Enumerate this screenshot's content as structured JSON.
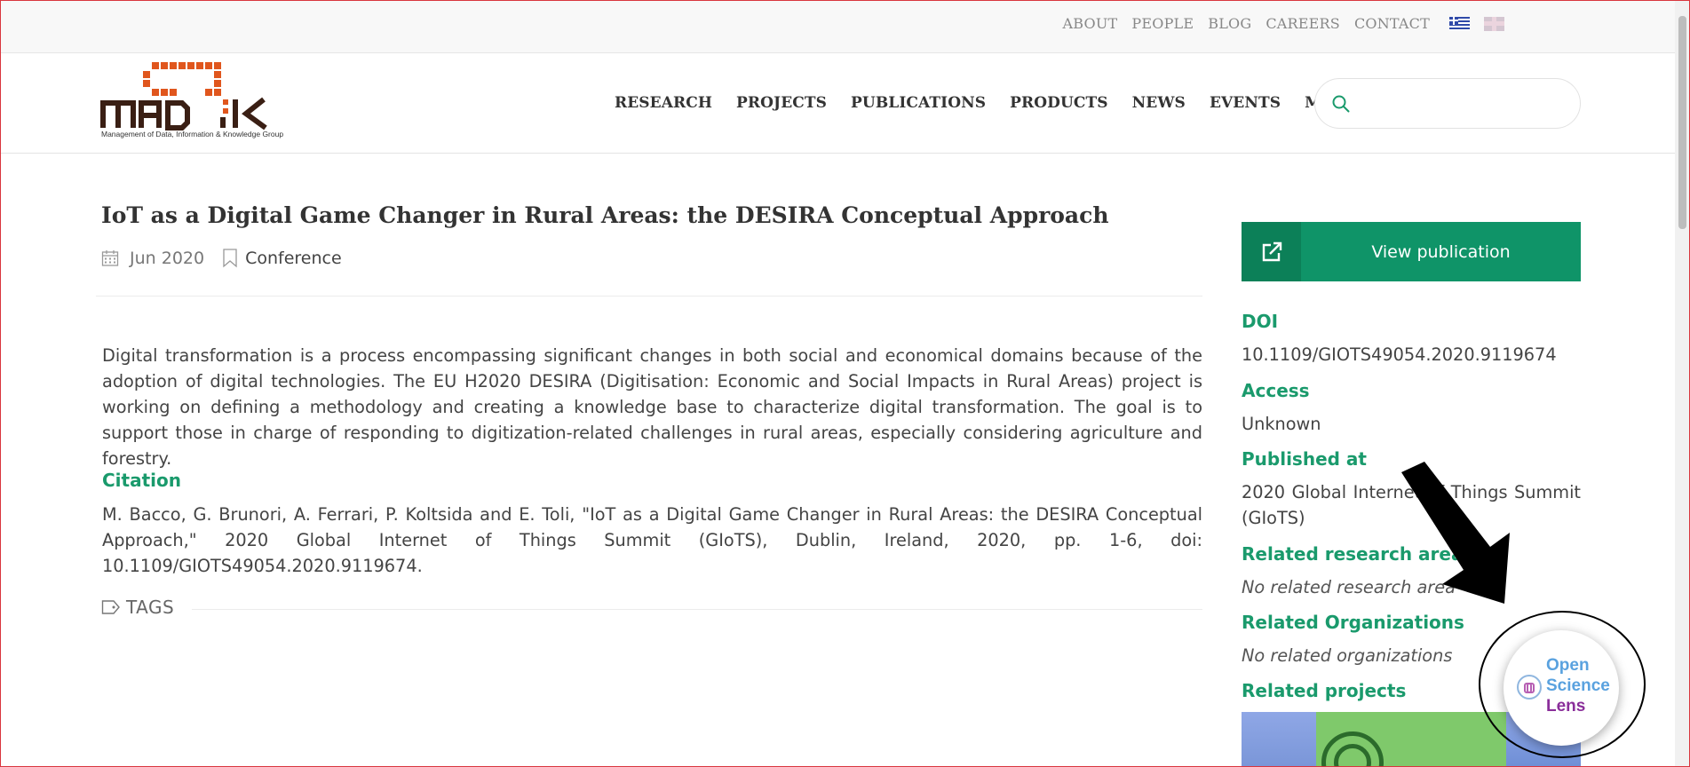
{
  "top_nav": {
    "items": [
      "ABOUT",
      "PEOPLE",
      "BLOG",
      "CAREERS",
      "CONTACT"
    ],
    "languages": [
      "greek-flag-icon",
      "uk-flag-icon"
    ]
  },
  "logo": {
    "text": "MAD IK",
    "tagline": "Management of Data, Information & Knowledge Group",
    "colors": {
      "orange": "#e0561d",
      "dark": "#3a1f14"
    }
  },
  "main_nav": {
    "items": [
      "RESEARCH",
      "PROJECTS",
      "PUBLICATIONS",
      "PRODUCTS",
      "NEWS",
      "EVENTS",
      "MEDIA"
    ]
  },
  "search": {
    "placeholder": "",
    "value": "",
    "icon": "search-icon"
  },
  "article": {
    "title": "IoT as a Digital Game Changer in Rural Areas: the DESIRA Conceptual Approach",
    "date": "Jun 2020",
    "type": "Conference",
    "abstract": "Digital transformation is a process encompassing significant changes in both social and economical domains because of the adoption of digital technologies. The EU H2020 DESIRA (Digitisation: Economic and Social Impacts in Rural Areas) project is working on defining a methodology and creating a knowledge base to characterize digital transformation. The goal is to support those in charge of responding to digitization-related challenges in rural areas, especially considering agriculture and forestry.",
    "citation_heading": "Citation",
    "citation": "M. Bacco, G. Brunori, A. Ferrari, P. Koltsida and E. Toli, \"IoT as a Digital Game Changer in Rural Areas: the DESIRA Conceptual Approach,\" 2020 Global Internet of Things Summit (GIoTS), Dublin, Ireland, 2020, pp. 1-6, doi: 10.1109/GIOTS49054.2020.9119674.",
    "tags_label": "TAGS"
  },
  "sidebar": {
    "view_button": "View publication",
    "doi_label": "DOI",
    "doi": "10.1109/GIOTS49054.2020.9119674",
    "access_label": "Access",
    "access": "Unknown",
    "published_label": "Published at",
    "published": "2020 Global Internet of Things Summit (GIoTS)",
    "research_area_label": "Related research area",
    "research_area": "No related research area",
    "orgs_label": "Related Organizations",
    "orgs": "No related organizations",
    "projects_label": "Related projects"
  },
  "overlay": {
    "lens_line1": "Open",
    "lens_line2": "Science",
    "lens_line3": "Lens"
  },
  "colors": {
    "accent": "#1a9a6c",
    "button": "#0f9468",
    "button_icon_bg": "#0c8058",
    "lens_blue": "#5aa2df",
    "lens_purple": "#8a2e9a"
  }
}
